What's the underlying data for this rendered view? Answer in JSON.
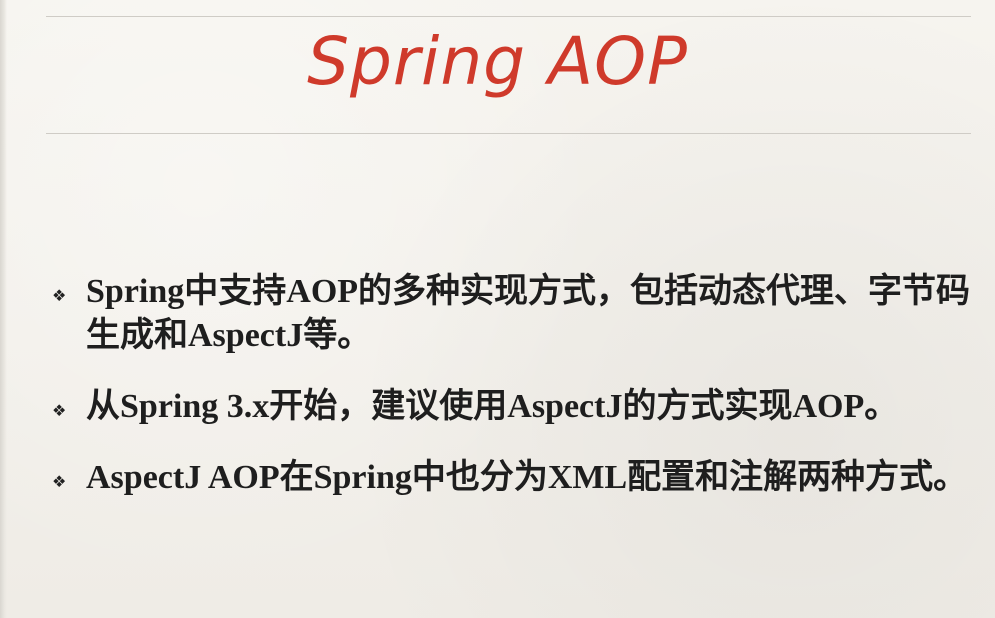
{
  "slide": {
    "title": "Spring AOP",
    "title_color": "#cf3a2b",
    "bullet_icon": "diamond-bullet-icon",
    "bullets": [
      "Spring中支持AOP的多种实现方式，包括动态代理、字节码生成和AspectJ等。",
      "从Spring 3.x开始，建议使用AspectJ的方式实现AOP。",
      "AspectJ AOP在Spring中也分为XML配置和注解两种方式。"
    ]
  }
}
